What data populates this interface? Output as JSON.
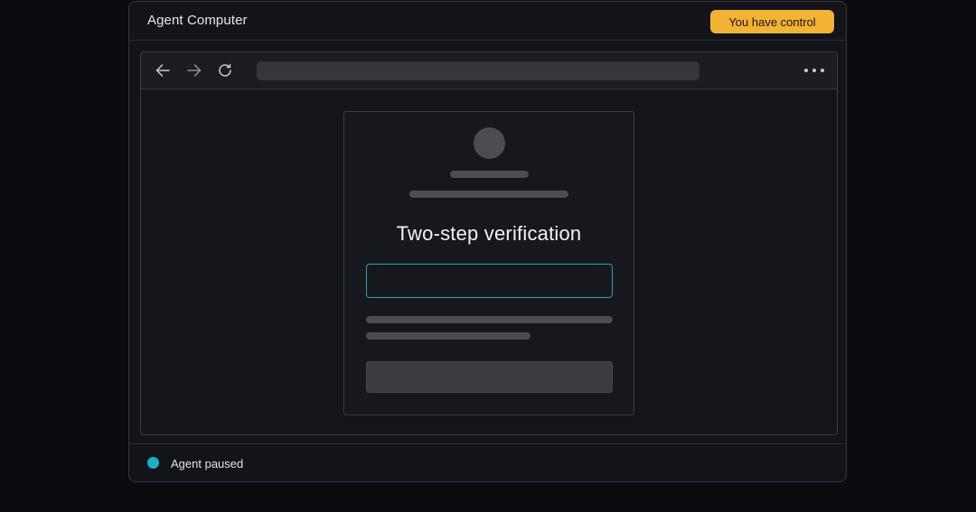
{
  "window": {
    "title": "Agent Computer",
    "control_button_label": "You have control"
  },
  "browser": {
    "nav_icons": [
      "back-arrow-icon",
      "forward-arrow-icon",
      "reload-icon"
    ],
    "menu_icon": "more-horizontal-icon"
  },
  "page": {
    "heading": "Two-step verification",
    "code_input_value": ""
  },
  "status": {
    "text": "Agent paused",
    "dot_color": "#1ab0c8"
  },
  "colors": {
    "accent": "#f2b233",
    "focus": "#1fa3b8"
  }
}
